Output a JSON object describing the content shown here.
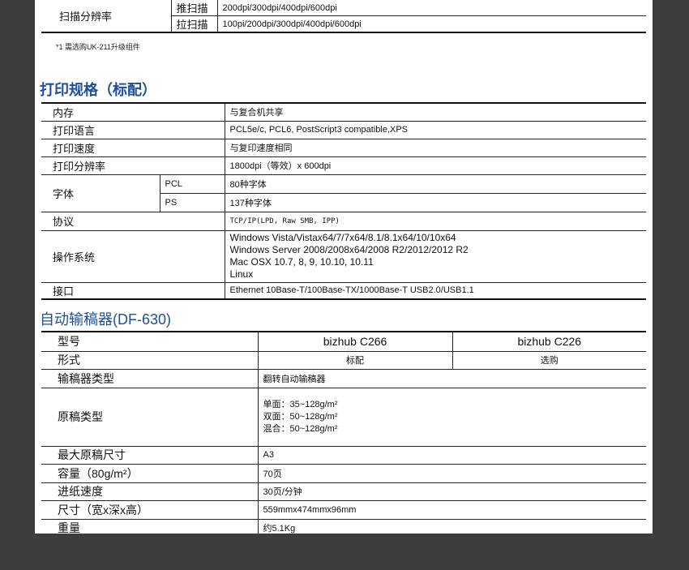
{
  "scan_resolution": {
    "label": "扫描分辨率",
    "rows": [
      {
        "mode": "推扫描",
        "value": "200dpi/300dpi/400dpi/600dpi"
      },
      {
        "mode": "拉扫描",
        "value": "100pi/200dpi/300dpi/400dpi/600dpi"
      }
    ]
  },
  "footnote": "*1 需选购UK-211升级组件",
  "print_specs": {
    "title": "打印规格（标配）",
    "memory": {
      "label": "内存",
      "value": "与复合机共享"
    },
    "language": {
      "label": "打印语言",
      "value": "PCL5e/c, PCL6, PostScript3 compatible,XPS"
    },
    "speed": {
      "label": "打印速度",
      "value": "与复印速度相同"
    },
    "resolution": {
      "label": "打印分辨率",
      "value": "1800dpi（等效）x 600dpi"
    },
    "fonts": {
      "label": "字体",
      "pcl": {
        "label": "PCL",
        "value": "80种字体"
      },
      "ps": {
        "label": "PS",
        "value": "137种字体"
      }
    },
    "protocol": {
      "label": "协议",
      "value": "TCP/IP(LPD, Raw SMB, IPP)"
    },
    "os": {
      "label": "操作系统",
      "lines": [
        "Windows Vista/Vistax64/7/7x64/8.1/8.1x64/10/10x64",
        "Windows Server 2008/2008x64/2008 R2/2012/2012 R2",
        "Mac OSX 10.7, 8, 9, 10.10, 10.11",
        "Linux"
      ]
    },
    "interface": {
      "label": "接口",
      "value": "Ethernet 10Base-T/100Base-TX/1000Base-T USB2.0/USB1.1"
    }
  },
  "adf": {
    "title": "自动输稿器(DF-630)",
    "model": {
      "label": "型号",
      "c266": "bizhub C266",
      "c226": "bizhub C226"
    },
    "form": {
      "label": "形式",
      "c266": "标配",
      "c226": "选购"
    },
    "type": {
      "label": "输稿器类型",
      "value": "翻转自动输稿器"
    },
    "original_type": {
      "label": "原稿类型",
      "lines": [
        "单面：35~128g/m²",
        "双面：50~128g/m²",
        "混合：50~128g/m²"
      ]
    },
    "max_size": {
      "label": "最大原稿尺寸",
      "value": "A3"
    },
    "capacity": {
      "label": "容量（80g/m²）",
      "value": "70页"
    },
    "feed_speed": {
      "label": "进纸速度",
      "value": "30页/分钟"
    },
    "dimensions": {
      "label": "尺寸（宽x深x高）",
      "value": "559mmx474mmx96mm"
    },
    "weight": {
      "label": "重量",
      "value": "约5.1Kg"
    }
  }
}
